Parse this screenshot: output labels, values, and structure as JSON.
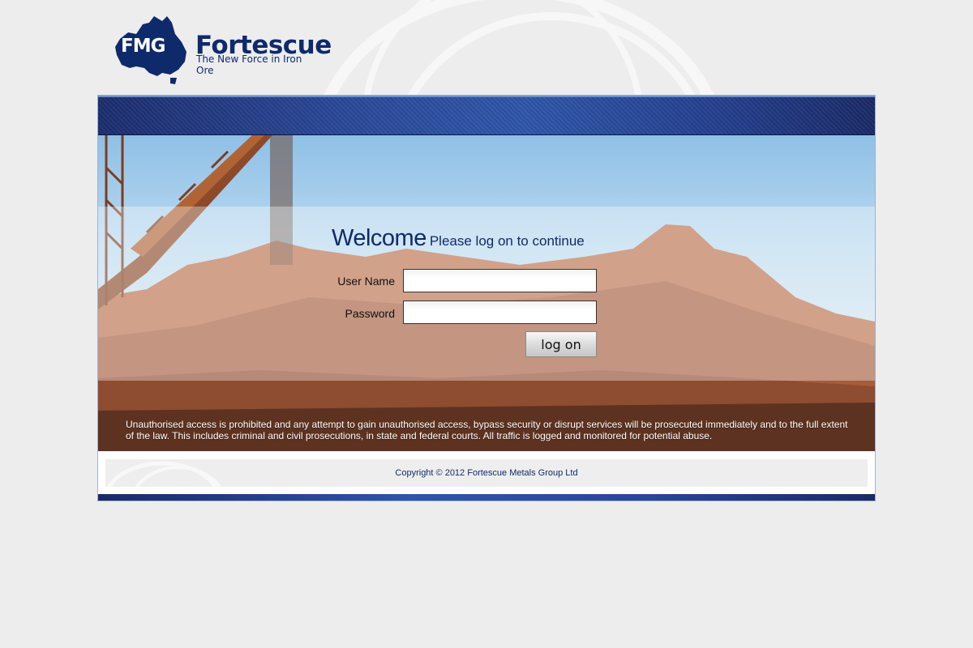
{
  "brand": {
    "mark_text": "FMG",
    "name": "Fortescue",
    "tagline": "The New Force in Iron Ore",
    "color": "#0f2a6b"
  },
  "login": {
    "welcome": "Welcome",
    "subtitle": "Please log on to continue",
    "username_label": "User Name",
    "username_value": "",
    "password_label": "Password",
    "password_value": "",
    "submit_label": "log on"
  },
  "notice": {
    "text": "Unauthorised access is prohibited and any attempt to gain unauthorised access, bypass security or disrupt services will be prosecuted immediately and to the full extent of the law. This includes criminal and civil prosecutions, in state and federal courts. All traffic is logged and monitored for potential abuse."
  },
  "footer": {
    "copyright": "Copyright © 2012 Fortescue Metals Group Ltd"
  },
  "icons": {
    "logo": "australia-map-logo-icon",
    "background": "swirl-decoration-icon"
  }
}
